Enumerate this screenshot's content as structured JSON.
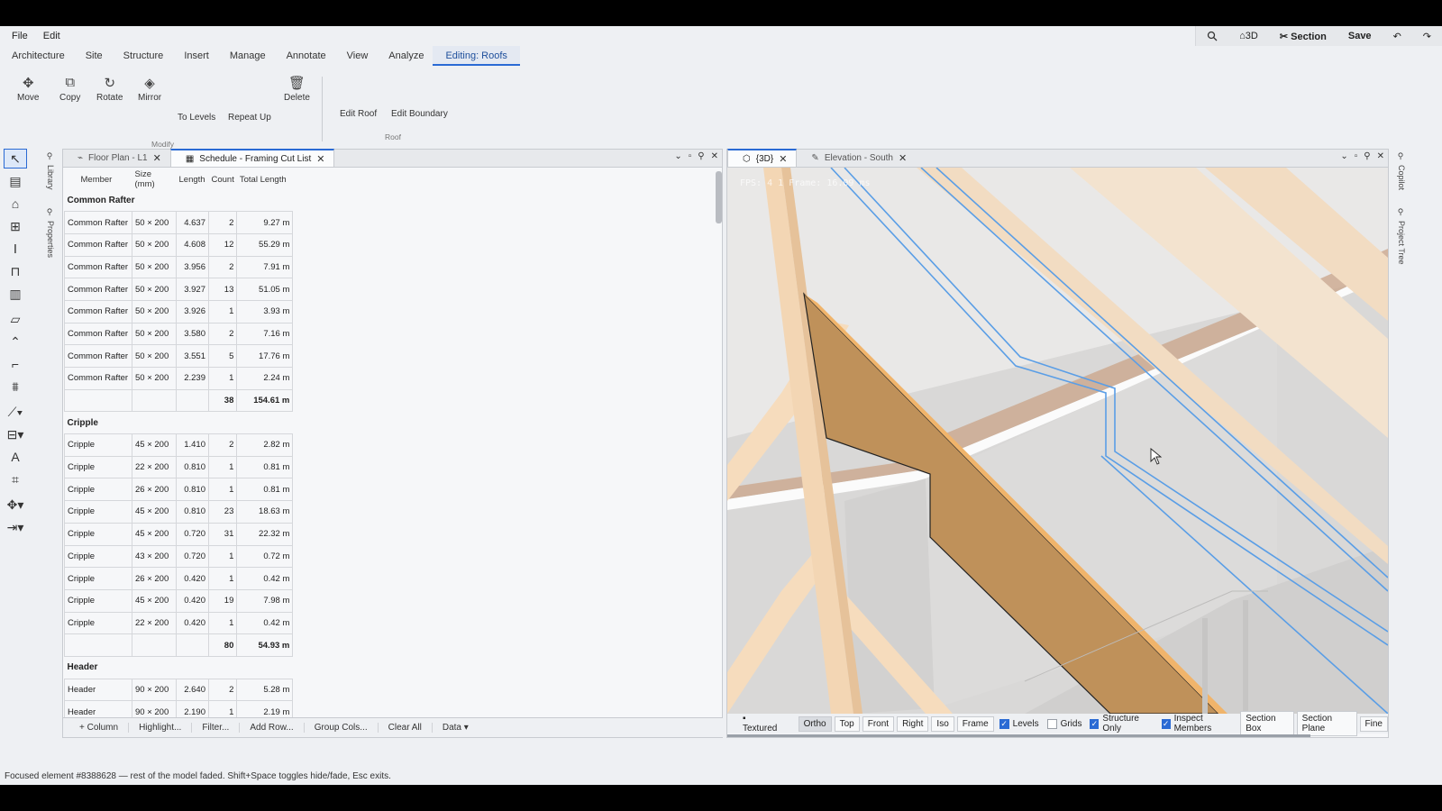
{
  "menubar": {
    "file": "File",
    "edit": "Edit"
  },
  "quick_actions": {
    "search_icon": "search-icon",
    "view3d": "⌂3D",
    "section": "✂ Section",
    "save": "Save"
  },
  "ribbon_tabs": [
    "Architecture",
    "Site",
    "Structure",
    "Insert",
    "Manage",
    "Annotate",
    "View",
    "Analyze",
    "Editing: Roofs"
  ],
  "ribbon": {
    "move": "Move",
    "copy": "Copy",
    "rotate": "Rotate",
    "mirror": "Mirror",
    "to_levels": "To Levels",
    "repeat_up": "Repeat Up",
    "delete": "Delete",
    "modify_group": "Modify",
    "edit_roof": "Edit Roof",
    "edit_boundary": "Edit Boundary",
    "roof_group": "Roof"
  },
  "side_panels": {
    "library": "Library",
    "properties": "Properties",
    "copilot": "Copilot",
    "project_tree": "Project Tree"
  },
  "left_pane": {
    "tabs": [
      {
        "label": "Floor Plan - L1"
      },
      {
        "label": "Schedule - Framing Cut List"
      }
    ],
    "headers": [
      "Member",
      "Size (mm)",
      "Length",
      "Count",
      "Total Length"
    ],
    "groups": [
      {
        "name": "Common Rafter",
        "rows": [
          [
            "Common Rafter",
            "50 × 200",
            "4.637",
            "2",
            "9.27 m"
          ],
          [
            "Common Rafter",
            "50 × 200",
            "4.608",
            "12",
            "55.29 m"
          ],
          [
            "Common Rafter",
            "50 × 200",
            "3.956",
            "2",
            "7.91 m"
          ],
          [
            "Common Rafter",
            "50 × 200",
            "3.927",
            "13",
            "51.05 m"
          ],
          [
            "Common Rafter",
            "50 × 200",
            "3.926",
            "1",
            "3.93 m"
          ],
          [
            "Common Rafter",
            "50 × 200",
            "3.580",
            "2",
            "7.16 m"
          ],
          [
            "Common Rafter",
            "50 × 200",
            "3.551",
            "5",
            "17.76 m"
          ],
          [
            "Common Rafter",
            "50 × 200",
            "2.239",
            "1",
            "2.24 m"
          ]
        ],
        "total_count": "38",
        "total_length": "154.61 m"
      },
      {
        "name": "Cripple",
        "rows": [
          [
            "Cripple",
            "45 × 200",
            "1.410",
            "2",
            "2.82 m"
          ],
          [
            "Cripple",
            "22 × 200",
            "0.810",
            "1",
            "0.81 m"
          ],
          [
            "Cripple",
            "26 × 200",
            "0.810",
            "1",
            "0.81 m"
          ],
          [
            "Cripple",
            "45 × 200",
            "0.810",
            "23",
            "18.63 m"
          ],
          [
            "Cripple",
            "45 × 200",
            "0.720",
            "31",
            "22.32 m"
          ],
          [
            "Cripple",
            "43 × 200",
            "0.720",
            "1",
            "0.72 m"
          ],
          [
            "Cripple",
            "26 × 200",
            "0.420",
            "1",
            "0.42 m"
          ],
          [
            "Cripple",
            "45 × 200",
            "0.420",
            "19",
            "7.98 m"
          ],
          [
            "Cripple",
            "22 × 200",
            "0.420",
            "1",
            "0.42 m"
          ]
        ],
        "total_count": "80",
        "total_length": "54.93 m"
      },
      {
        "name": "Header",
        "rows": [
          [
            "Header",
            "90 × 200",
            "2.640",
            "2",
            "5.28 m"
          ],
          [
            "Header",
            "90 × 200",
            "2.190",
            "1",
            "2.19 m"
          ]
        ]
      }
    ],
    "bottom_buttons": {
      "column": "+ Column",
      "highlight": "Highlight...",
      "filter": "Filter...",
      "add_row": "Add Row...",
      "group_cols": "Group Cols...",
      "clear_all": "Clear All",
      "data": "Data ▾"
    }
  },
  "right_pane": {
    "tabs": [
      {
        "label": "{3D}"
      },
      {
        "label": "Elevation - South"
      }
    ],
    "fps_text": "FPS: 4 1    Frame: 16.09 ms",
    "buttons": {
      "textured": "Textured",
      "ortho": "Ortho",
      "top": "Top",
      "front": "Front",
      "right": "Right",
      "iso": "Iso",
      "frame": "Frame",
      "section_box": "Section Box",
      "section_plane": "Section Plane",
      "fine": "Fine"
    },
    "checks": {
      "levels": "Levels",
      "grids": "Grids",
      "structure_only": "Structure Only",
      "inspect_members": "Inspect Members"
    }
  },
  "status": "Focused element #8388628 — rest of the model faded. Shift+Space toggles hide/fade, Esc exits.",
  "colors": {
    "accent": "#2a6ad4",
    "rafter_orange": "#c59a5c",
    "highlight_edge": "#5a9ee6"
  }
}
